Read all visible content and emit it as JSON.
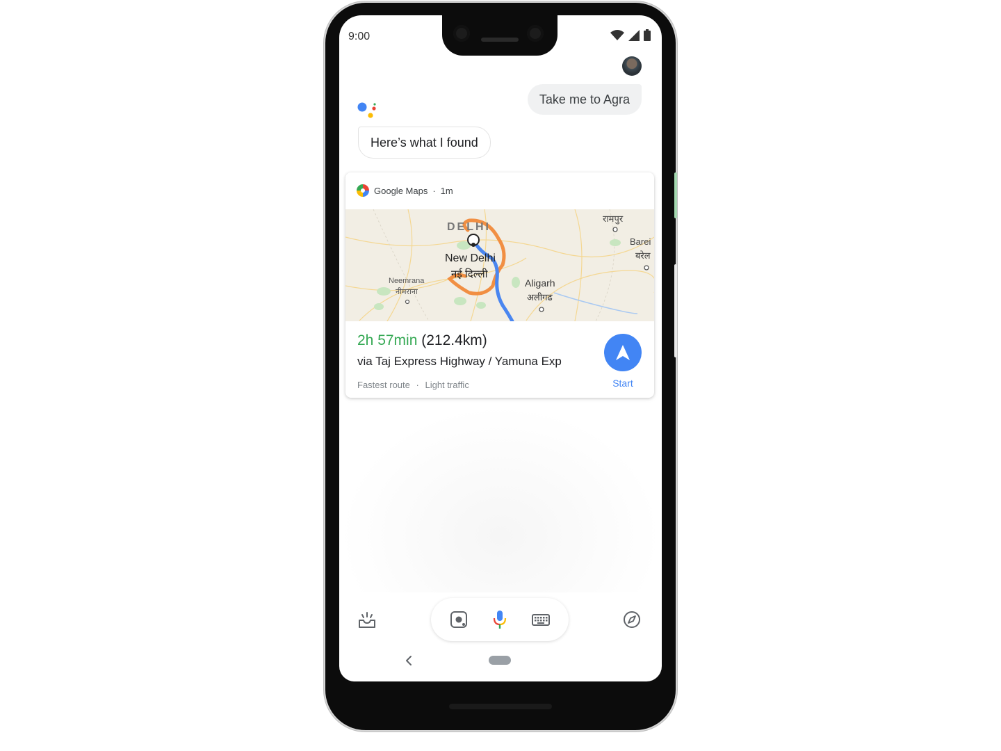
{
  "status_bar": {
    "time": "9:00",
    "icons": [
      "wifi-icon",
      "signal-icon",
      "battery-icon"
    ]
  },
  "conversation": {
    "user_query": "Take me to Agra",
    "assistant_reply": "Here’s what I found"
  },
  "maps_card": {
    "source": "Google Maps",
    "separator": "·",
    "age": "1m",
    "map_labels": {
      "delhi": "DELHI",
      "new_delhi": "New Delhi",
      "new_delhi_hi": "नई दिल्ली",
      "rampur": "रामपुर",
      "bareilly": "Barei",
      "bareilly_hi": "बरेल",
      "neemrana": "Neemrana",
      "neemrana_hi": "नीमराना",
      "aligarh": "Aligarh",
      "aligarh_hi": "अलीगढ"
    },
    "duration": "2h 57min",
    "distance": "(212.4km)",
    "via": "via Taj Express Highway / Yamuna Exp",
    "route_type": "Fastest route",
    "traffic": "Light traffic",
    "start_label": "Start"
  },
  "colors": {
    "accent_blue": "#4285f4",
    "duration_green": "#34a853",
    "route_orange": "#f08a3c",
    "route_blue": "#4a86f0"
  },
  "toolbar": {
    "left_icon": "snapshot-tray-icon",
    "lens_icon": "lens-icon",
    "mic_icon": "mic-icon",
    "keyboard_icon": "keyboard-icon",
    "right_icon": "compass-icon"
  }
}
